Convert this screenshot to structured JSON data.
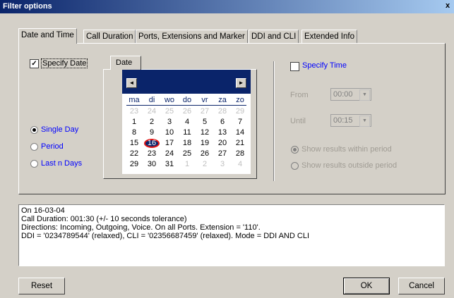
{
  "window": {
    "title": "Filter options",
    "close_glyph": "x"
  },
  "tabs": [
    "Date and Time",
    "Call Duration",
    "Ports, Extensions and Marker",
    "DDI and CLI",
    "Extended Info"
  ],
  "date": {
    "specify_label": "Specify Date",
    "specify_checked": true,
    "tab_label": "Date",
    "options": [
      {
        "label": "Single Day",
        "checked": true
      },
      {
        "label": "Period",
        "checked": false
      },
      {
        "label": "Last n Days",
        "checked": false
      }
    ]
  },
  "calendar": {
    "weekdays": [
      "ma",
      "di",
      "wo",
      "do",
      "vr",
      "za",
      "zo"
    ],
    "weeks": [
      [
        "23",
        "24",
        "25",
        "26",
        "27",
        "28",
        "29"
      ],
      [
        "1",
        "2",
        "3",
        "4",
        "5",
        "6",
        "7"
      ],
      [
        "8",
        "9",
        "10",
        "11",
        "12",
        "13",
        "14"
      ],
      [
        "15",
        "16",
        "17",
        "18",
        "19",
        "20",
        "21"
      ],
      [
        "22",
        "23",
        "24",
        "25",
        "26",
        "27",
        "28"
      ],
      [
        "29",
        "30",
        "31",
        "1",
        "2",
        "3",
        "4"
      ]
    ],
    "selected": "16",
    "prev_icon": "◄",
    "next_icon": "►"
  },
  "time": {
    "specify_label": "Specify Time",
    "specify_checked": false,
    "from_label": "From",
    "from_value": "00:00",
    "until_label": "Until",
    "until_value": "00:15",
    "within_label": "Show results within period",
    "outside_label": "Show results outside period",
    "combo_arrow": "▼"
  },
  "summary": [
    "On 16-03-04",
    "Call Duration: 001:30 (+/- 10 seconds tolerance)",
    "Directions: Incoming, Outgoing, Voice.  On all Ports.  Extension = '110'.",
    "DDI = '0234789544' (relaxed), CLI = '02356687459' (relaxed).  Mode = DDI AND CLI"
  ],
  "buttons": {
    "reset": "Reset",
    "ok": "OK",
    "cancel": "Cancel"
  },
  "colors": {
    "title_bar": "#0a246a",
    "link_text": "#0000ff",
    "selected_day_ring": "#e01818"
  }
}
